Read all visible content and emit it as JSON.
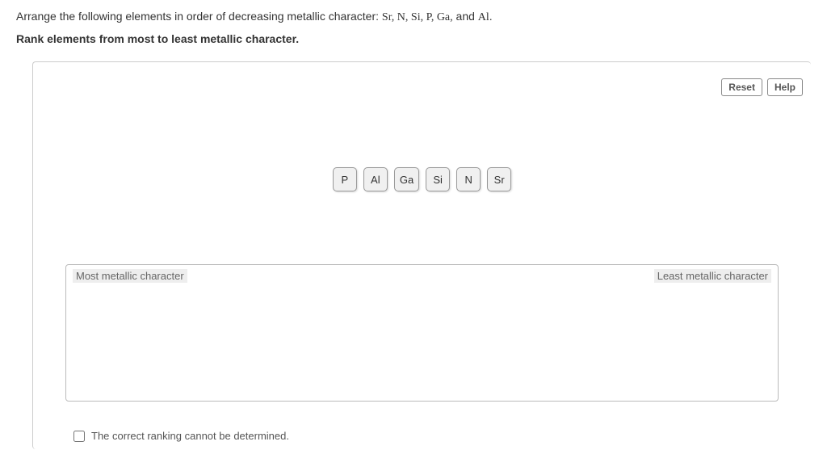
{
  "question": {
    "prefix": "Arrange the following elements in order of decreasing metallic character: ",
    "elements_text": "Sr, N, Si, P, Ga,",
    "and": " and ",
    "last_element": "Al",
    "period": "."
  },
  "instruction": "Rank elements from most to least metallic character.",
  "toolbar": {
    "reset": "Reset",
    "help": "Help"
  },
  "tiles": [
    "P",
    "Al",
    "Ga",
    "Si",
    "N",
    "Sr"
  ],
  "dropzone": {
    "left_label": "Most metallic character",
    "right_label": "Least metallic character"
  },
  "checkbox": {
    "label": "The correct ranking cannot be determined."
  }
}
